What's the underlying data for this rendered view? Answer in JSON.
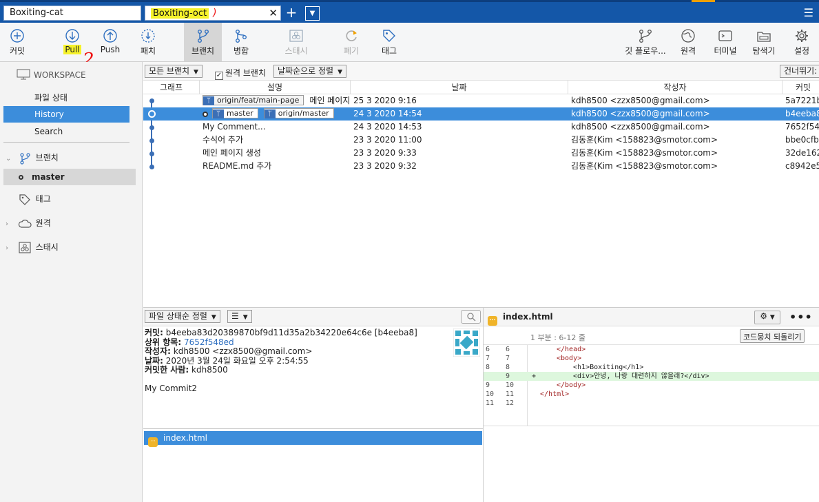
{
  "tabs": [
    {
      "label": "Boxiting-cat"
    },
    {
      "label": "Boxiting-oct",
      "annotation": ")"
    }
  ],
  "toolbar": {
    "commit": "커밋",
    "pull": "Pull",
    "push": "Push",
    "patch": "패치",
    "branch": "브랜치",
    "merge": "병합",
    "stash": "스태시",
    "discard": "폐기",
    "tag": "태그",
    "git_flow": "깃 플로우...",
    "remote": "원격",
    "terminal": "터미널",
    "explorer": "탐색기",
    "settings": "설정",
    "annotation": "2"
  },
  "sidebar": {
    "workspace": "WORKSPACE",
    "file_status": "파일 상태",
    "history": "History",
    "search": "Search",
    "branches": "브랜치",
    "master": "master",
    "tags": "태그",
    "remotes": "원격",
    "stashes": "스태시"
  },
  "filter": {
    "branches": "모든 브랜치",
    "remote_branches": "원격 브랜치",
    "sort": "날짜순으로 정렬",
    "jump": "건너뛰기:"
  },
  "columns": {
    "graph": "그래프",
    "description": "설명",
    "date": "날짜",
    "author": "작성자",
    "commit": "커밋"
  },
  "commits": [
    {
      "refs": [
        "origin/feat/main-page"
      ],
      "message": "메인 페이지",
      "date": "25 3 2020 9:16",
      "author": "kdh8500 <zzx8500@gmail.com>",
      "hash": "5a7221b"
    },
    {
      "refs": [
        "master",
        "origin/master"
      ],
      "message": "",
      "date": "24 3 2020 14:54",
      "author": "kdh8500 <zzx8500@gmail.com>",
      "hash": "b4eeba8"
    },
    {
      "refs": [],
      "message": "My Comment...",
      "date": "24 3 2020 14:53",
      "author": "kdh8500 <zzx8500@gmail.com>",
      "hash": "7652f54"
    },
    {
      "refs": [],
      "message": "수식어 추가",
      "date": "23 3 2020 11:00",
      "author": "김동훈(Kim <158823@smotor.com>",
      "hash": "bbe0cfb"
    },
    {
      "refs": [],
      "message": "메인 페이지 생성",
      "date": "23 3 2020 9:33",
      "author": "김동훈(Kim <158823@smotor.com>",
      "hash": "32de162"
    },
    {
      "refs": [],
      "message": "README.md 추가",
      "date": "23 3 2020 9:32",
      "author": "김동훈(Kim <158823@smotor.com>",
      "hash": "c8942e5"
    }
  ],
  "details": {
    "sort_label": "파일 상태순 정렬",
    "commit_label": "커밋:",
    "commit_value": "b4eeba83d20389870bf9d11d35a2b34220e64c6e [b4eeba8]",
    "parent_label": "상위 항목:",
    "parent_value": "7652f548ed",
    "author_label": "작성자:",
    "author_value": "kdh8500 <zzx8500@gmail.com>",
    "date_label": "날짜:",
    "date_value": "2020년 3월 24일 화요일 오후 2:54:55",
    "committer_label": "커밋한 사람:",
    "committer_value": "kdh8500",
    "message": "My Commit2"
  },
  "files": [
    {
      "name": "index.html"
    }
  ],
  "diff": {
    "filename": "index.html",
    "hunk": "1 부분 : 6-12 줄",
    "revert": "코드뭉치 되돌리기",
    "lines": [
      {
        "old": "6",
        "new": "6",
        "mark": "",
        "indent": "  ",
        "text": "</head>"
      },
      {
        "old": "7",
        "new": "7",
        "mark": "",
        "indent": "  ",
        "text": "<body>"
      },
      {
        "old": "8",
        "new": "8",
        "mark": "",
        "indent": "    ",
        "text": "<h1>Boxiting</h1>"
      },
      {
        "old": "",
        "new": "9",
        "mark": "+",
        "indent": "    ",
        "text": "<div>안녕, 나랑 대련하지 않을래?</div>"
      },
      {
        "old": "9",
        "new": "10",
        "mark": "",
        "indent": "  ",
        "text": "</body>"
      },
      {
        "old": "10",
        "new": "11",
        "mark": "",
        "indent": "",
        "text": "</html>"
      },
      {
        "old": "11",
        "new": "12",
        "mark": "",
        "indent": "",
        "text": ""
      }
    ]
  }
}
